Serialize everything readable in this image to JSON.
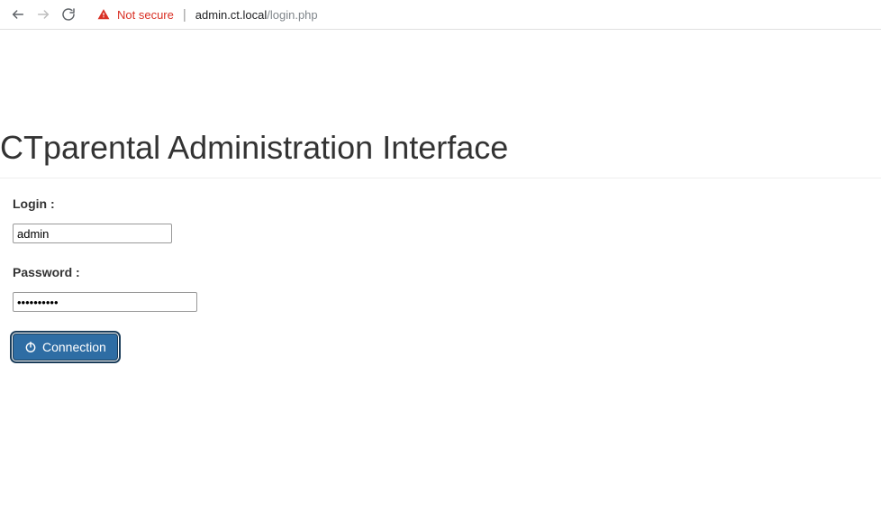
{
  "browser": {
    "not_secure_label": "Not secure",
    "url_host": "admin.ct.local",
    "url_path": "/login.php"
  },
  "page": {
    "title": "CTparental Administration Interface",
    "login_label": "Login :",
    "login_value": "admin",
    "password_label": "Password :",
    "password_value": "••••••••••",
    "connection_button": "Connection"
  }
}
